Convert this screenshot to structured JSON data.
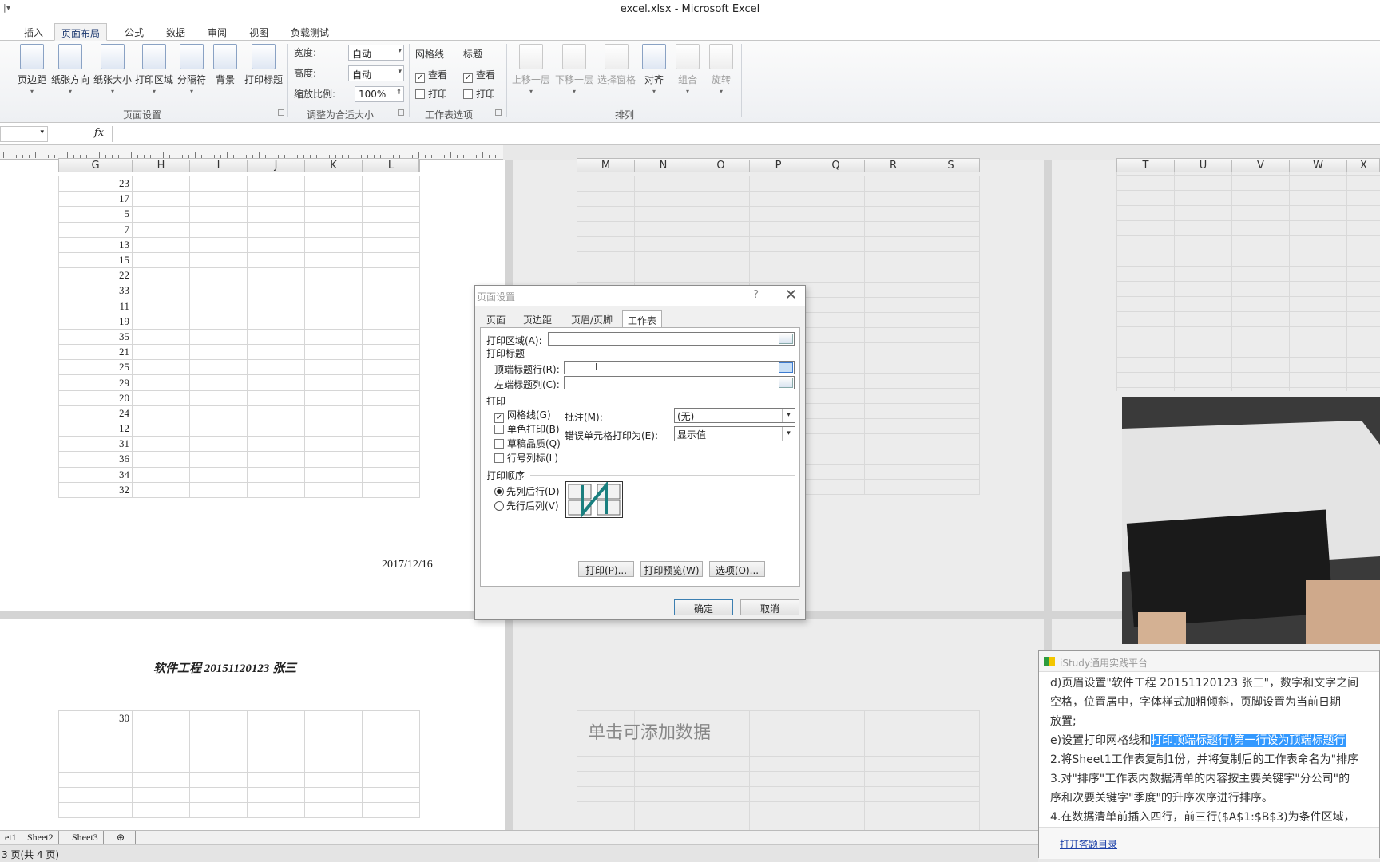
{
  "window": {
    "title": "excel.xlsx  -  Microsoft Excel",
    "qat": "|▾"
  },
  "tabs": [
    "插入",
    "页面布局",
    "公式",
    "数据",
    "审阅",
    "视图",
    "负载测试"
  ],
  "ribbon": {
    "page_setup": {
      "buttons": [
        "页边距",
        "纸张方向",
        "纸张大小",
        "打印区域",
        "分隔符",
        "背景",
        "打印标题"
      ],
      "label": "页面设置"
    },
    "scale_to_fit": {
      "width_label": "宽度:",
      "width_value": "自动",
      "height_label": "高度:",
      "height_value": "自动",
      "scale_label": "缩放比例:",
      "scale_value": "100%",
      "label": "调整为合适大小"
    },
    "sheet_options": {
      "gridlines": "网格线",
      "headings": "标题",
      "view": "查看",
      "print": "打印",
      "label": "工作表选项"
    },
    "arrange": {
      "buttons": [
        "上移一层",
        "下移一层",
        "选择窗格",
        "对齐",
        "组合",
        "旋转"
      ],
      "label": "排列"
    }
  },
  "formula_bar": {
    "fx": "fx",
    "value": ""
  },
  "columns_page1": [
    "G",
    "H",
    "I",
    "J",
    "K",
    "L"
  ],
  "columns_page2": [
    "M",
    "N",
    "O",
    "P",
    "Q",
    "R",
    "S"
  ],
  "columns_page3": [
    "T",
    "U",
    "V",
    "W",
    "X"
  ],
  "values": [
    "23",
    "17",
    "5",
    "7",
    "13",
    "15",
    "22",
    "33",
    "11",
    "19",
    "35",
    "21",
    "25",
    "29",
    "20",
    "24",
    "12",
    "31",
    "36",
    "34",
    "32"
  ],
  "footer_date": "2017/12/16",
  "header_text": "软件工程 20151120123 张三",
  "page2_value": "30",
  "add_data_hint": "单击可添加数据",
  "dialog": {
    "title": "页面设置",
    "help": "?",
    "close": "✕",
    "tabs": [
      "页面",
      "页边距",
      "页眉/页脚",
      "工作表"
    ],
    "print_area_label": "打印区域(A):",
    "print_titles_label": "打印标题",
    "rows_repeat_label": "顶端标题行(R):",
    "cols_repeat_label": "左端标题列(C):",
    "print_label": "打印",
    "gridlines": "网格线(G)",
    "black_white": "单色打印(B)",
    "draft": "草稿品质(Q)",
    "row_col_headings": "行号列标(L)",
    "comments_label": "批注(M):",
    "comments_value": "(无)",
    "errors_label": "错误单元格打印为(E):",
    "errors_value": "显示值",
    "page_order_label": "打印顺序",
    "down_then_over": "先列后行(D)",
    "over_then_down": "先行后列(V)",
    "btn_print": "打印(P)...",
    "btn_preview": "打印预览(W)",
    "btn_options": "选项(O)...",
    "btn_ok": "确定",
    "btn_cancel": "取消"
  },
  "istudy": {
    "title": "iStudy通用实践平台",
    "line1": "d)页眉设置\"软件工程 20151120123 张三\"，数字和文字之间",
    "line2": "空格，位置居中，字体样式加粗倾斜，页脚设置为当前日期",
    "line3": "放置;",
    "line4_pre": "e)设置打印网格线和",
    "line4_sel": "打印顶端标题行(第一行设为顶端标题行",
    "line5": "2.将Sheet1工作表复制1份，并将复制后的工作表命名为\"排序",
    "line6": "3.对\"排序\"工作表内数据清单的内容按主要关键字\"分公司\"的",
    "line7": "序和次要关键字\"季度\"的升序次序进行排序。",
    "line8": "4.在数据清单前插入四行，前三行($A$1:$B$3)为条件区域，",
    "link": "打开答题目录"
  },
  "sheets": [
    "et1",
    "Sheet2",
    "Sheet3"
  ],
  "status": "3 页(共 4 页)"
}
